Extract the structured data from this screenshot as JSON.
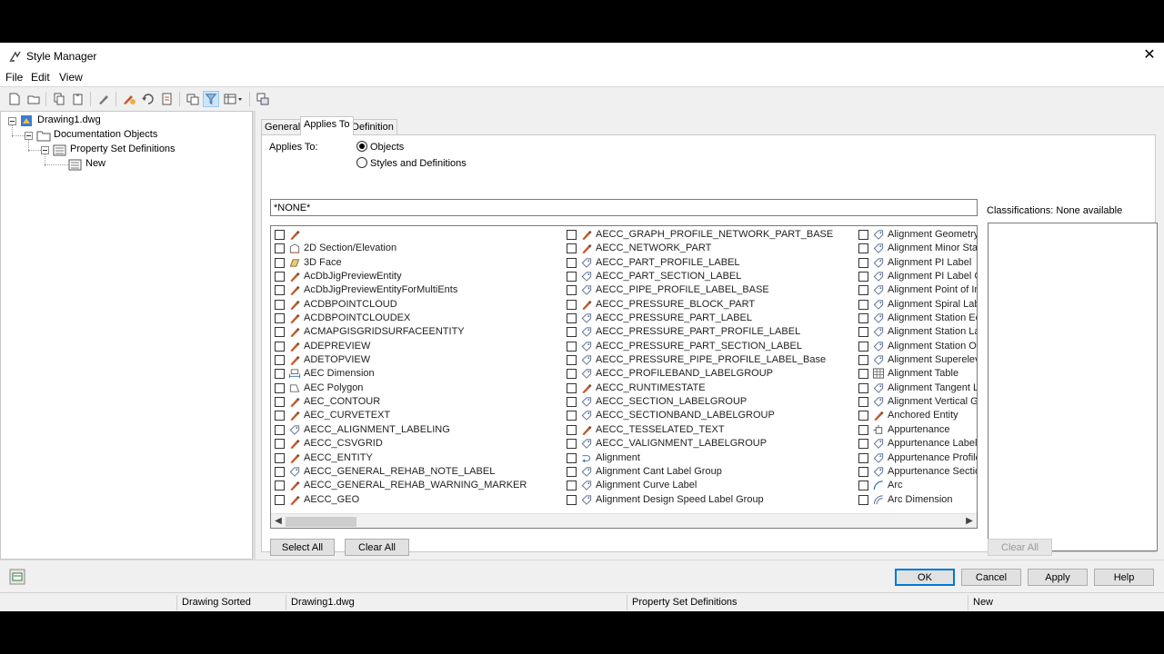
{
  "window": {
    "title": "Style Manager",
    "close_glyph": "✕"
  },
  "menu": [
    "File",
    "Edit",
    "View"
  ],
  "toolbar": {
    "icons": [
      "new-drawing-icon",
      "open-drawing-icon",
      "copy-icon",
      "paste-icon",
      "edit-style-icon",
      "purge-icon",
      "toggle-view-icon",
      "inline-edit-icon",
      "sort-icon",
      "filter-style-type-icon",
      "show-all-icon",
      "view-options-icon",
      "synchronize-icon"
    ]
  },
  "tree": {
    "drawing": "Drawing1.dwg",
    "category": "Documentation Objects",
    "group": "Property Set Definitions",
    "item": "New"
  },
  "tabs": [
    "General",
    "Applies To",
    "Definition"
  ],
  "applies_to": {
    "label": "Applies To:",
    "option_objects": "Objects",
    "option_styles": "Styles and Definitions",
    "filter_value": "*NONE*"
  },
  "objects": {
    "col1": [
      {
        "label": "",
        "icon": "brush-icon"
      },
      {
        "label": "2D Section/Elevation",
        "icon": "section-elevation-icon"
      },
      {
        "label": "3D Face",
        "icon": "face-icon"
      },
      {
        "label": "AcDbJigPreviewEntity",
        "icon": "brush-icon"
      },
      {
        "label": "AcDbJigPreviewEntityForMultiEnts",
        "icon": "brush-icon"
      },
      {
        "label": "ACDBPOINTCLOUD",
        "icon": "brush-icon"
      },
      {
        "label": "ACDBPOINTCLOUDEX",
        "icon": "brush-icon"
      },
      {
        "label": "ACMAPGISGRIDSURFACEENTITY",
        "icon": "brush-icon"
      },
      {
        "label": "ADEPREVIEW",
        "icon": "brush-icon"
      },
      {
        "label": "ADETOPVIEW",
        "icon": "brush-icon"
      },
      {
        "label": "AEC Dimension",
        "icon": "dimension-icon"
      },
      {
        "label": "AEC Polygon",
        "icon": "polygon-icon"
      },
      {
        "label": "AEC_CONTOUR",
        "icon": "brush-icon"
      },
      {
        "label": "AEC_CURVETEXT",
        "icon": "brush-icon"
      },
      {
        "label": "AECC_ALIGNMENT_LABELING",
        "icon": "label-tag-icon"
      },
      {
        "label": "AECC_CSVGRID",
        "icon": "brush-icon"
      },
      {
        "label": "AECC_ENTITY",
        "icon": "brush-icon"
      },
      {
        "label": "AECC_GENERAL_REHAB_NOTE_LABEL",
        "icon": "label-tag-icon"
      },
      {
        "label": "AECC_GENERAL_REHAB_WARNING_MARKER",
        "icon": "brush-icon"
      },
      {
        "label": "AECC_GEO",
        "icon": "brush-icon"
      }
    ],
    "col2": [
      {
        "label": "AECC_GRAPH_PROFILE_NETWORK_PART_BASE",
        "icon": "brush-icon"
      },
      {
        "label": "AECC_NETWORK_PART",
        "icon": "brush-icon"
      },
      {
        "label": "AECC_PART_PROFILE_LABEL",
        "icon": "label-tag-icon"
      },
      {
        "label": "AECC_PART_SECTION_LABEL",
        "icon": "label-tag-icon"
      },
      {
        "label": "AECC_PIPE_PROFILE_LABEL_BASE",
        "icon": "label-tag-icon"
      },
      {
        "label": "AECC_PRESSURE_BLOCK_PART",
        "icon": "brush-icon"
      },
      {
        "label": "AECC_PRESSURE_PART_LABEL",
        "icon": "label-tag-icon"
      },
      {
        "label": "AECC_PRESSURE_PART_PROFILE_LABEL",
        "icon": "label-tag-icon"
      },
      {
        "label": "AECC_PRESSURE_PART_SECTION_LABEL",
        "icon": "label-tag-icon"
      },
      {
        "label": "AECC_PRESSURE_PIPE_PROFILE_LABEL_Base",
        "icon": "label-tag-icon"
      },
      {
        "label": "AECC_PROFILEBAND_LABELGROUP",
        "icon": "label-tag-icon"
      },
      {
        "label": "AECC_RUNTIMESTATE",
        "icon": "brush-icon"
      },
      {
        "label": "AECC_SECTION_LABELGROUP",
        "icon": "label-tag-icon"
      },
      {
        "label": "AECC_SECTIONBAND_LABELGROUP",
        "icon": "label-tag-icon"
      },
      {
        "label": "AECC_TESSELATED_TEXT",
        "icon": "brush-icon"
      },
      {
        "label": "AECC_VALIGNMENT_LABELGROUP",
        "icon": "label-tag-icon"
      },
      {
        "label": "Alignment",
        "icon": "alignment-icon"
      },
      {
        "label": "Alignment Cant Label Group",
        "icon": "label-tag-icon"
      },
      {
        "label": "Alignment Curve Label",
        "icon": "label-tag-icon"
      },
      {
        "label": "Alignment Design Speed Label Group",
        "icon": "label-tag-icon"
      }
    ],
    "col3": [
      {
        "label": "Alignment Geometry",
        "icon": "label-tag-icon"
      },
      {
        "label": "Alignment Minor Sta",
        "icon": "label-tag-icon"
      },
      {
        "label": "Alignment PI Label",
        "icon": "label-tag-icon"
      },
      {
        "label": "Alignment PI Label G",
        "icon": "label-tag-icon"
      },
      {
        "label": "Alignment Point of In",
        "icon": "label-tag-icon"
      },
      {
        "label": "Alignment Spiral Lab",
        "icon": "label-tag-icon"
      },
      {
        "label": "Alignment Station Ec",
        "icon": "label-tag-icon"
      },
      {
        "label": "Alignment Station La",
        "icon": "label-tag-icon"
      },
      {
        "label": "Alignment Station Of",
        "icon": "label-tag-icon"
      },
      {
        "label": "Alignment Superelev",
        "icon": "label-tag-icon"
      },
      {
        "label": "Alignment Table",
        "icon": "table-icon"
      },
      {
        "label": "Alignment Tangent L",
        "icon": "label-tag-icon"
      },
      {
        "label": "Alignment Vertical G",
        "icon": "label-tag-icon"
      },
      {
        "label": "Anchored Entity",
        "icon": "brush-icon"
      },
      {
        "label": "Appurtenance",
        "icon": "appurtenance-icon"
      },
      {
        "label": "Appurtenance Label",
        "icon": "label-tag-icon"
      },
      {
        "label": "Appurtenance Profile",
        "icon": "label-tag-icon"
      },
      {
        "label": "Appurtenance Sectio",
        "icon": "label-tag-icon"
      },
      {
        "label": "Arc",
        "icon": "arc-icon"
      },
      {
        "label": "Arc Dimension",
        "icon": "arc-dimension-icon"
      }
    ]
  },
  "buttons": {
    "select_all": "Select All",
    "clear_all": "Clear All",
    "class_clear_all": "Clear All",
    "ok": "OK",
    "cancel": "Cancel",
    "apply": "Apply",
    "help": "Help"
  },
  "classifications": {
    "label": "Classifications: None available"
  },
  "status": {
    "sort": "Drawing Sorted",
    "drawing": "Drawing1.dwg",
    "category": "Property Set Definitions",
    "style": "New"
  },
  "colors": {
    "accent": "#0078d7",
    "brush": "#c0582a",
    "tag": "#5b6b8c"
  }
}
